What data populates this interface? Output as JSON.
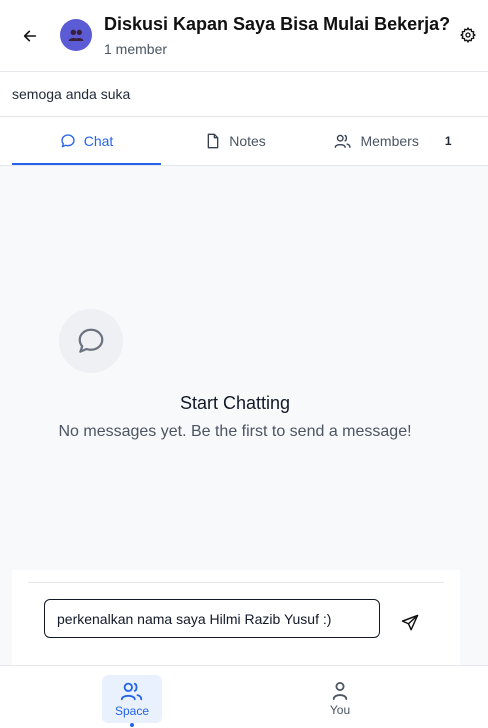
{
  "header": {
    "title": "Diskusi Kapan Saya Bisa Mulai Bekerja?",
    "subtitle": "1 member",
    "back_icon": "arrow-left-icon",
    "settings_icon": "gear-icon",
    "avatar_color": "#5b5bd6"
  },
  "description": "semoga anda suka",
  "tabs": [
    {
      "label": "Chat",
      "icon": "chat-bubble-icon",
      "active": true
    },
    {
      "label": "Notes",
      "icon": "document-icon",
      "active": false
    },
    {
      "label": "Members",
      "icon": "users-icon",
      "active": false,
      "badge": "1"
    }
  ],
  "empty_state": {
    "title": "Start Chatting",
    "text": "No messages yet. Be the first to send a message!"
  },
  "composer": {
    "value": "perkenalkan nama saya Hilmi Razib Yusuf :)",
    "send_icon": "send-icon"
  },
  "bottom_nav": [
    {
      "label": "Space",
      "icon": "users-icon",
      "active": true
    },
    {
      "label": "You",
      "icon": "user-icon",
      "active": false
    }
  ],
  "colors": {
    "accent": "#2563eb",
    "background": "#f8f9fb"
  }
}
